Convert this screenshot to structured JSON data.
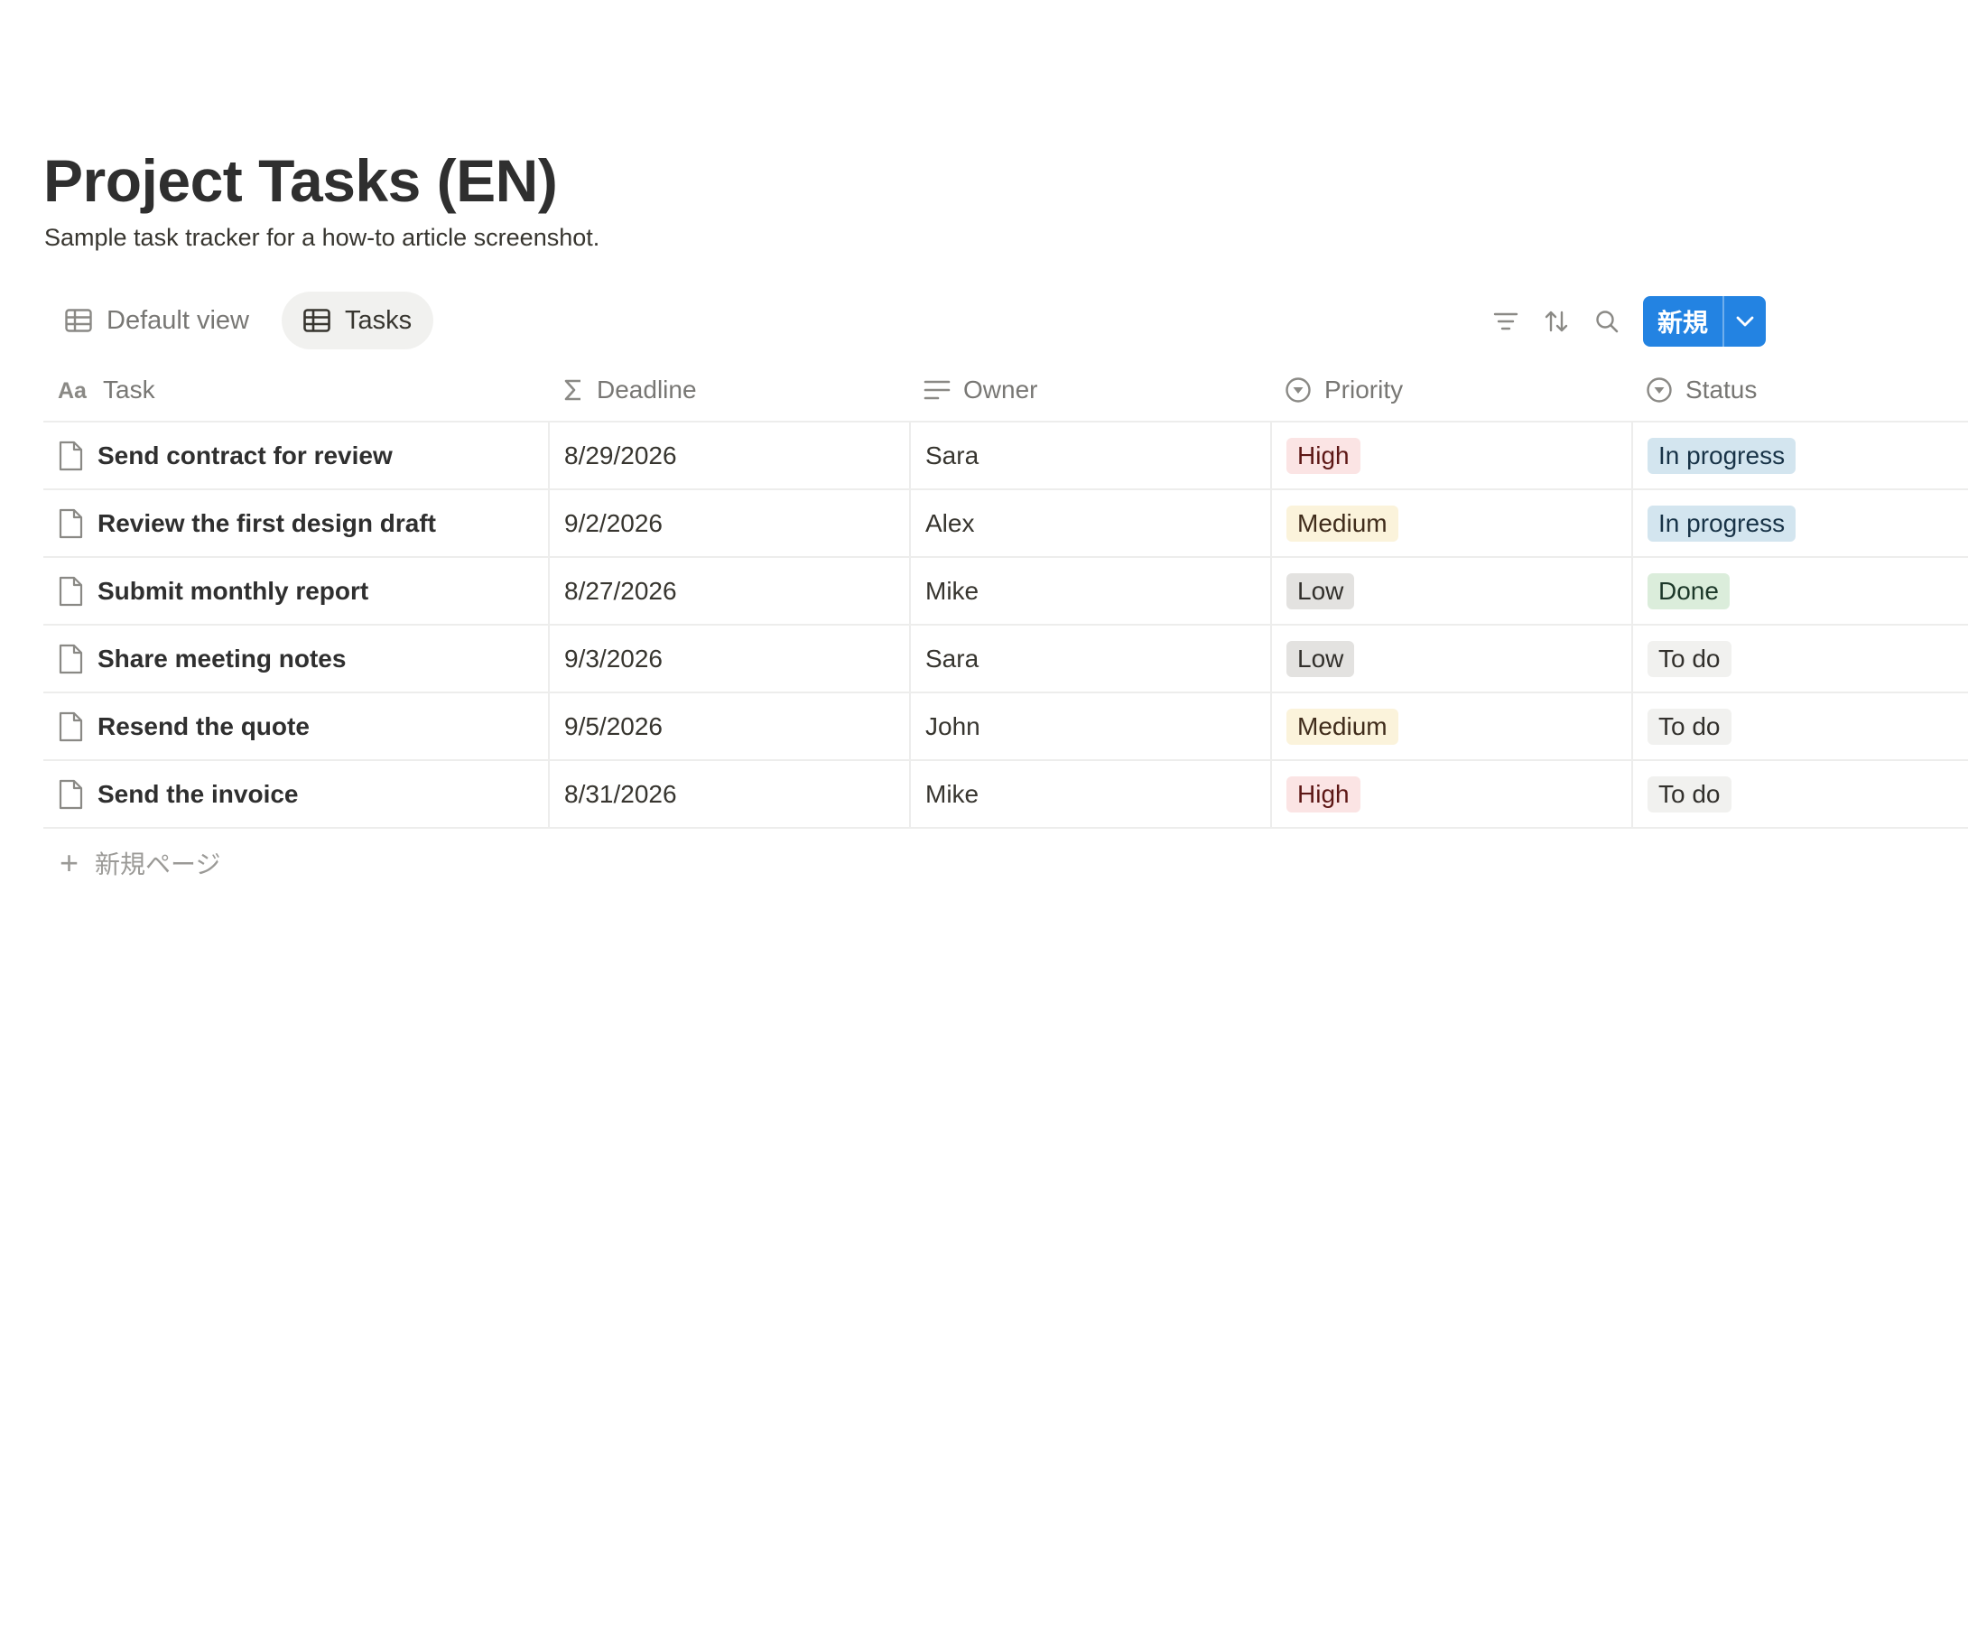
{
  "page": {
    "title": "Project Tasks (EN)",
    "subtitle": "Sample task tracker for a how-to article screenshot."
  },
  "views": [
    {
      "label": "Default view",
      "icon": "table-icon",
      "active": false
    },
    {
      "label": "Tasks",
      "icon": "table-icon",
      "active": true
    }
  ],
  "toolbar": {
    "icons": [
      "filter-icon",
      "sort-icon",
      "search-icon"
    ],
    "new_label": "新規",
    "new_dropdown_icon": "chevron-down-icon"
  },
  "table": {
    "columns": [
      {
        "label": "Task",
        "icon": "text-property-icon"
      },
      {
        "label": "Deadline",
        "icon": "formula-icon"
      },
      {
        "label": "Owner",
        "icon": "text-lines-icon"
      },
      {
        "label": "Priority",
        "icon": "select-icon"
      },
      {
        "label": "Status",
        "icon": "select-icon"
      }
    ],
    "rows": [
      {
        "task": "Send contract for review",
        "deadline": "8/29/2026",
        "owner": "Sara",
        "priority": "High",
        "status": "In progress"
      },
      {
        "task": "Review the first design draft",
        "deadline": "9/2/2026",
        "owner": "Alex",
        "priority": "Medium",
        "status": "In progress"
      },
      {
        "task": "Submit monthly report",
        "deadline": "8/27/2026",
        "owner": "Mike",
        "priority": "Low",
        "status": "Done"
      },
      {
        "task": "Share meeting notes",
        "deadline": "9/3/2026",
        "owner": "Sara",
        "priority": "Low",
        "status": "To do"
      },
      {
        "task": "Resend the quote",
        "deadline": "9/5/2026",
        "owner": "John",
        "priority": "Medium",
        "status": "To do"
      },
      {
        "task": "Send the invoice",
        "deadline": "8/31/2026",
        "owner": "Mike",
        "priority": "High",
        "status": "To do"
      }
    ],
    "add_row_label": "新規ページ"
  },
  "tag_colors": {
    "High": {
      "bg": "#fbe4e4",
      "fg": "#5d1715"
    },
    "Medium": {
      "bg": "#fbf3db",
      "fg": "#402c1b"
    },
    "Low": {
      "bg": "#e3e2e0",
      "fg": "#32302c"
    },
    "In progress": {
      "bg": "#d3e5ef",
      "fg": "#183347"
    },
    "Done": {
      "bg": "#dbeddb",
      "fg": "#1c3829"
    },
    "To do": {
      "bg": "#f1f1ef",
      "fg": "#32302c"
    }
  }
}
